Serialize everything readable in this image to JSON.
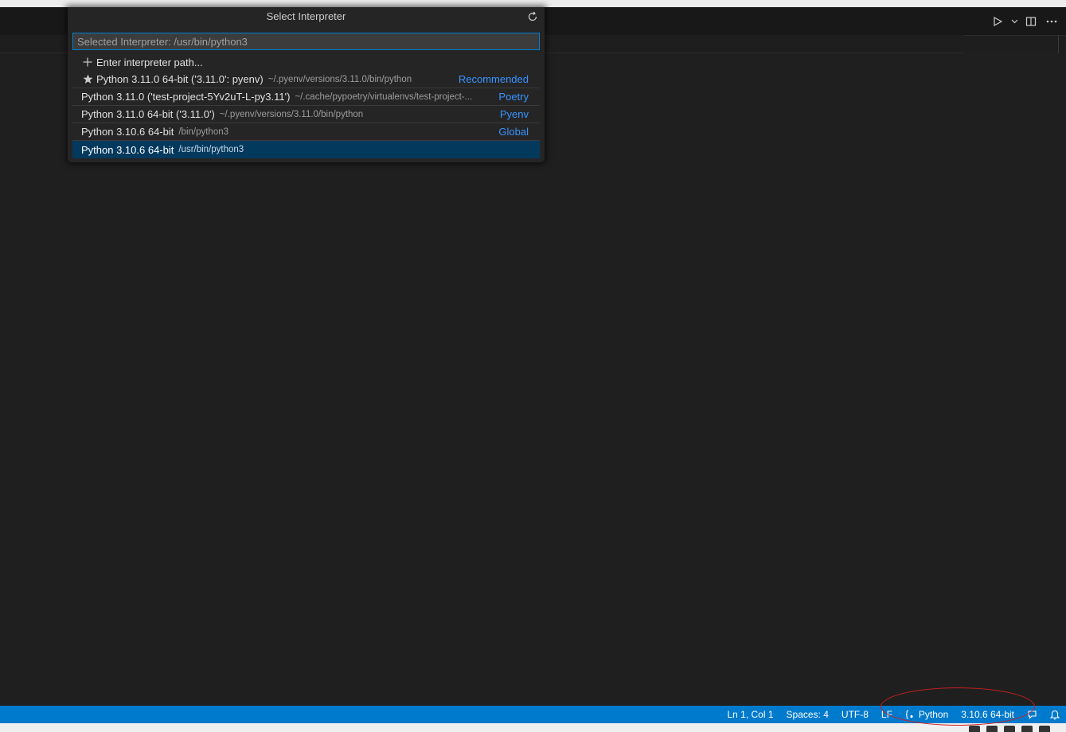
{
  "quick_pick": {
    "title": "Select Interpreter",
    "input_placeholder": "Selected Interpreter: /usr/bin/python3",
    "enter_path_label": "Enter interpreter path...",
    "items": [
      {
        "label": "Python 3.11.0 64-bit ('3.11.0': pyenv)",
        "description": "~/.pyenv/versions/3.11.0/bin/python",
        "tag": "Recommended",
        "icon": "star-icon"
      },
      {
        "label": "Python 3.11.0 ('test-project-5Yv2uT-L-py3.11')",
        "description": "~/.cache/pypoetry/virtualenvs/test-project-...",
        "tag": "Poetry"
      },
      {
        "label": "Python 3.11.0 64-bit ('3.11.0')",
        "description": "~/.pyenv/versions/3.11.0/bin/python",
        "tag": "Pyenv"
      },
      {
        "label": "Python 3.10.6 64-bit",
        "description": "/bin/python3",
        "tag": "Global"
      },
      {
        "label": "Python 3.10.6 64-bit",
        "description": "/usr/bin/python3",
        "tag": ""
      }
    ]
  },
  "status_bar": {
    "cursor": "Ln 1, Col 1",
    "spaces": "Spaces: 4",
    "encoding": "UTF-8",
    "eol": "LF",
    "language": "Python",
    "interpreter": "3.10.6 64-bit"
  },
  "colors": {
    "status_bar": "#007acc",
    "selected_item": "#04395e",
    "tag": "#3794ff",
    "annotation": "#cc1f1f"
  }
}
